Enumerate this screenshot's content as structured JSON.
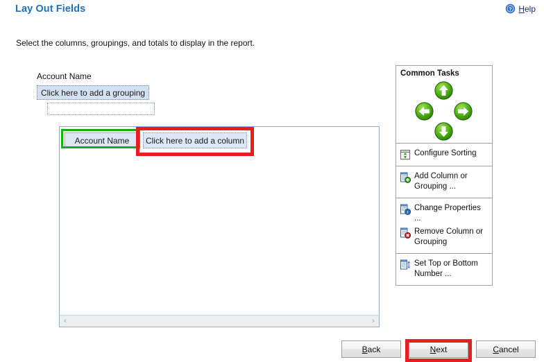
{
  "header": {
    "title": "Lay Out Fields",
    "help_label": "Help",
    "help_mnemonic": "H",
    "help_rest": "elp",
    "help_icon": "help-question-circle-icon",
    "title_color": "#1f6fc4"
  },
  "instruction": "Select the columns, groupings, and totals to display in the report.",
  "grouping": {
    "field_label": "Account Name",
    "add_grouping_text": "Click here to add a grouping",
    "empty_slot_text": ""
  },
  "design_surface": {
    "column_label": "Account Name",
    "add_column_text": "Click here to add a column",
    "scroll_left_glyph": "‹",
    "scroll_right_glyph": "›"
  },
  "common_tasks": {
    "title": "Common Tasks",
    "dpad": [
      {
        "name": "move-up-button",
        "icon": "arrow-up-circle-icon",
        "direction": "up"
      },
      {
        "name": "move-left-button",
        "icon": "arrow-left-circle-icon",
        "direction": "left"
      },
      {
        "name": "move-right-button",
        "icon": "arrow-right-circle-icon",
        "direction": "right"
      },
      {
        "name": "move-down-button",
        "icon": "arrow-down-circle-icon",
        "direction": "down"
      }
    ],
    "sections": [
      {
        "items": [
          {
            "label": "Configure Sorting",
            "icon": "configure-sorting-icon"
          }
        ]
      },
      {
        "items": [
          {
            "label": "Add Column or Grouping ...",
            "icon": "add-column-or-grouping-icon"
          }
        ]
      },
      {
        "items": [
          {
            "label": "Change Properties ...",
            "icon": "change-properties-icon"
          },
          {
            "label": "Remove Column or Grouping",
            "icon": "remove-column-or-grouping-icon"
          }
        ]
      },
      {
        "items": [
          {
            "label": "Set Top or Bottom Number ...",
            "icon": "set-top-or-bottom-number-icon"
          }
        ]
      }
    ]
  },
  "footer": {
    "buttons": [
      {
        "name": "back-button",
        "mnemonic": "B",
        "rest": "ack",
        "label": "Back"
      },
      {
        "name": "next-button",
        "mnemonic": "N",
        "rest": "ext",
        "label": "Next"
      },
      {
        "name": "cancel-button",
        "mnemonic": "C",
        "rest": "ancel",
        "label": "Cancel"
      }
    ]
  },
  "annotations": {
    "green_highlight_color": "#13b013",
    "red_highlight_color": "#e91d1d",
    "green_target": "Account Name column header",
    "red_targets": [
      "Click here to add a column",
      "Next"
    ]
  }
}
